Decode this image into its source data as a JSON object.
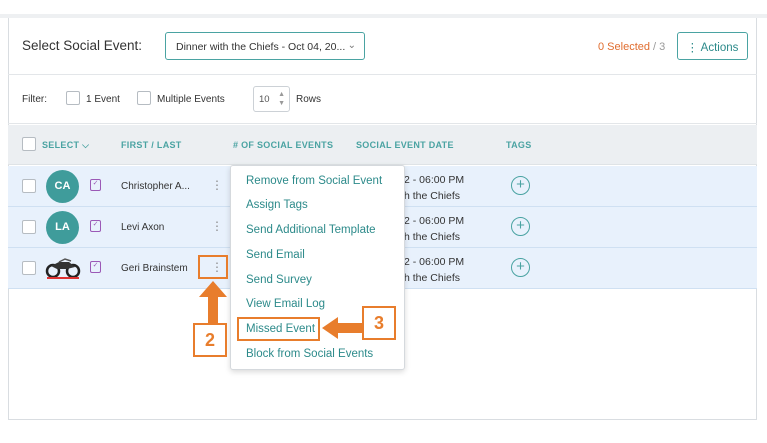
{
  "header": {
    "title": "Select Social Event:",
    "event_select": "Dinner with the Chiefs - Oct 04, 20...",
    "selected_count": "0 Selected",
    "selected_total": " / 3",
    "actions_label": "⋮ Actions"
  },
  "filter": {
    "label": "Filter:",
    "option1": "1 Event",
    "option2": "Multiple Events",
    "rows_value": "10",
    "rows_label": "Rows"
  },
  "table": {
    "columns": [
      "SELECT ⌵",
      "FIRST / LAST",
      "# OF SOCIAL EVENTS",
      "SOCIAL EVENT DATE",
      "TAGS"
    ],
    "rows": [
      {
        "initials": "CA",
        "name": "Christopher A...",
        "date_line1": "2 - 06:00 PM",
        "date_line2": "h the Chiefs"
      },
      {
        "initials": "LA",
        "name": "Levi Axon",
        "date_line1": "2 - 06:00 PM",
        "date_line2": "h the Chiefs"
      },
      {
        "initials": "",
        "name": "Geri Brainstem",
        "date_line1": "2 - 06:00 PM",
        "date_line2": "h the Chiefs"
      }
    ]
  },
  "menu": {
    "items": [
      "Remove from Social Event",
      "Assign Tags",
      "Send Additional Template",
      "Send Email",
      "Send Survey",
      "View Email Log",
      "Missed Event",
      "Block from Social Events"
    ]
  },
  "annotations": {
    "step2": "2",
    "step3": "3"
  },
  "colors": {
    "teal": "#4aa3a2",
    "orange": "#e87d2c",
    "row_highlight": "#e8f1fc"
  }
}
